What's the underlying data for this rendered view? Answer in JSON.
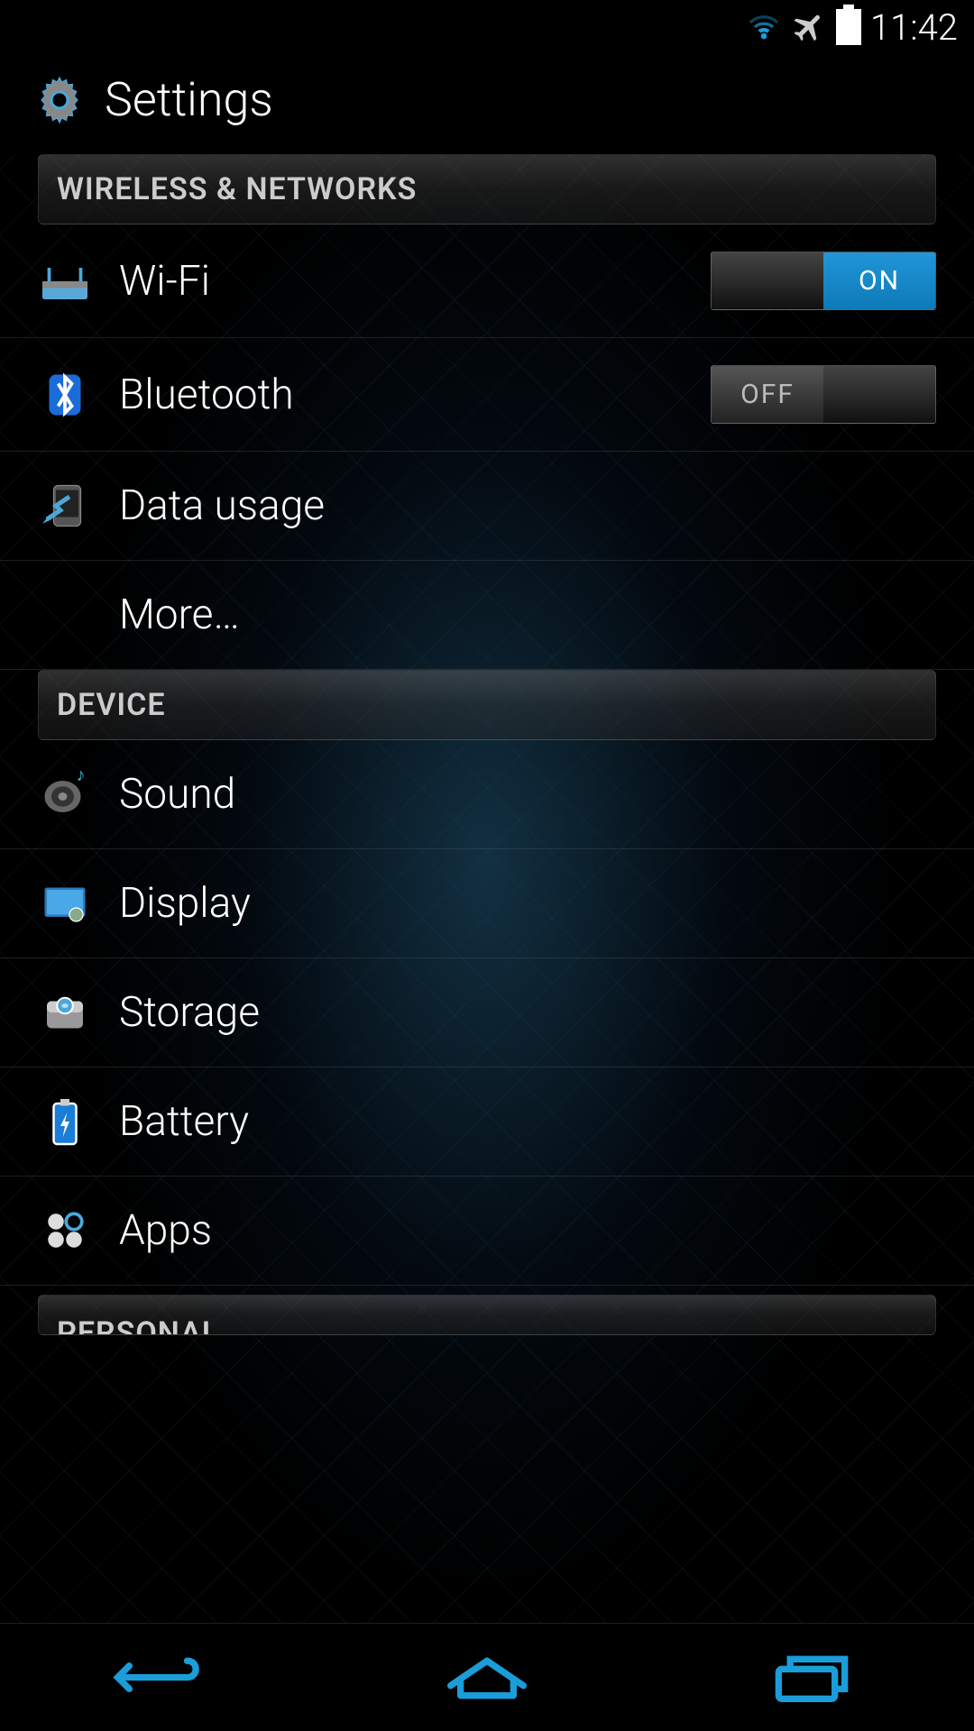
{
  "status_bar": {
    "time": "11:42"
  },
  "header": {
    "title": "Settings"
  },
  "sections": {
    "wireless": {
      "header": "WIRELESS & NETWORKS",
      "items": {
        "wifi": {
          "label": "Wi-Fi",
          "toggle": "ON"
        },
        "bluetooth": {
          "label": "Bluetooth",
          "toggle": "OFF"
        },
        "data_usage": {
          "label": "Data usage"
        },
        "more": {
          "label": "More…"
        }
      }
    },
    "device": {
      "header": "DEVICE",
      "items": {
        "sound": {
          "label": "Sound"
        },
        "display": {
          "label": "Display"
        },
        "storage": {
          "label": "Storage"
        },
        "battery": {
          "label": "Battery"
        },
        "apps": {
          "label": "Apps"
        }
      }
    },
    "personal": {
      "header": "PERSONAL"
    }
  },
  "toggle_labels": {
    "on": "ON",
    "off": "OFF"
  },
  "colors": {
    "accent": "#1a9dd9",
    "toggle_on": "#2196d8"
  }
}
